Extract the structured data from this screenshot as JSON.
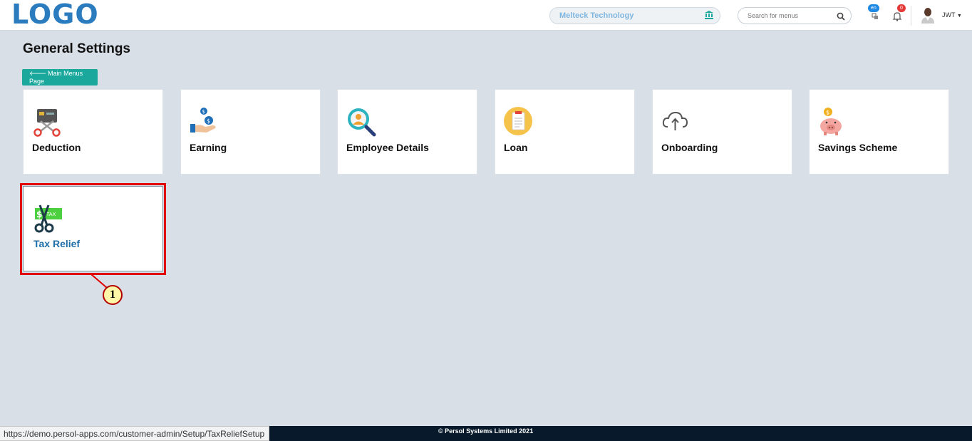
{
  "header": {
    "logo": "LOGO",
    "company": "Melteck Technology",
    "search_placeholder": "Search for menus",
    "lang_badge": "en",
    "notif_count": "0",
    "user": "JWT"
  },
  "page": {
    "title": "General Settings",
    "back_label": "Main Menus Page"
  },
  "cards": [
    {
      "label": "Deduction",
      "icon": "scissors-card-icon"
    },
    {
      "label": "Earning",
      "icon": "hand-coins-icon"
    },
    {
      "label": "Employee Details",
      "icon": "user-search-icon"
    },
    {
      "label": "Loan",
      "icon": "loan-clipboard-icon"
    },
    {
      "label": "Onboarding",
      "icon": "cloud-upload-icon"
    },
    {
      "label": "Savings Scheme",
      "icon": "piggy-bank-icon"
    },
    {
      "label": "Tax Relief",
      "icon": "tax-scissors-icon"
    }
  ],
  "annotation": {
    "callout": "1",
    "color": "#e00000"
  },
  "footer": {
    "copyright": "© Persol Systems Limited 2021"
  },
  "status_bar": {
    "url": "https://demo.persol-apps.com/customer-admin/Setup/TaxReliefSetup"
  }
}
